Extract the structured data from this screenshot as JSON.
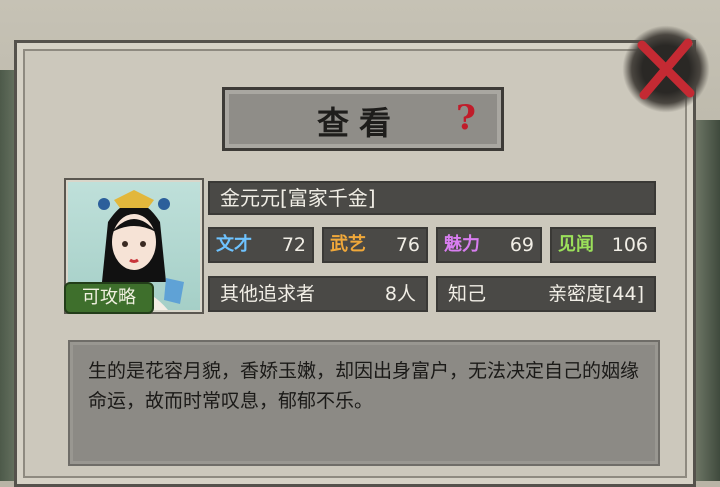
{
  "dialog": {
    "title": "查看",
    "help_icon": "question-icon",
    "close_icon": "close-icon"
  },
  "character": {
    "name": "金元元[富家千金]",
    "badge": "可攻略",
    "stats": [
      {
        "label": "文才",
        "value": "72",
        "color": "#6ec3ff"
      },
      {
        "label": "武艺",
        "value": "76",
        "color": "#f0a83a"
      },
      {
        "label": "魅力",
        "value": "69",
        "color": "#d87ef0"
      },
      {
        "label": "见闻",
        "value": "106",
        "color": "#9be05a"
      }
    ],
    "suitors_label": "其他追求者",
    "suitors_value": "8人",
    "relation_label": "知己",
    "intimacy": "亲密度[44]",
    "description": "生的是花容月貌，香娇玉嫩，却因出身富户，无法决定自己的姻缘命运，故而时常叹息，郁郁不乐。"
  }
}
